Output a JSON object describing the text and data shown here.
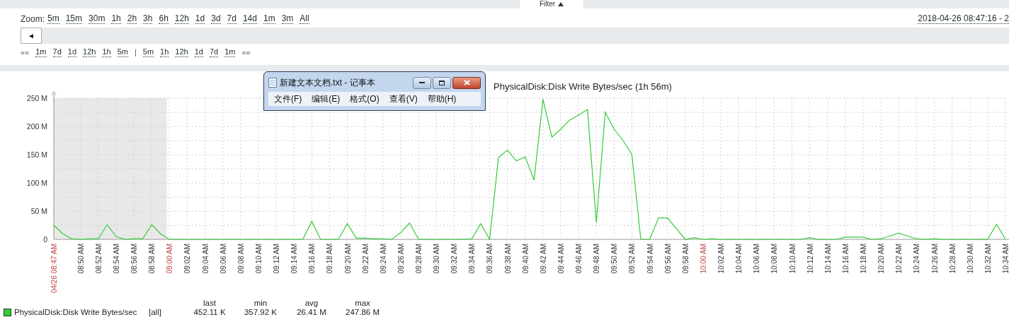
{
  "filter_tab": {
    "label": "Filter"
  },
  "zoom": {
    "label": "Zoom:",
    "options": [
      "5m",
      "15m",
      "30m",
      "1h",
      "2h",
      "3h",
      "6h",
      "12h",
      "1d",
      "3d",
      "7d",
      "14d",
      "1m",
      "3m",
      "All"
    ]
  },
  "time_range": "2018-04-26 08:47:16 - 2",
  "scroll_left_button": {
    "label": "◄"
  },
  "navigation": {
    "back_label": "««",
    "back": [
      "1m",
      "7d",
      "1d",
      "12h",
      "1h",
      "5m"
    ],
    "separator": "|",
    "forward": [
      "5m",
      "1h",
      "12h",
      "1d",
      "7d",
      "1m"
    ],
    "forward_label": "»»"
  },
  "notepad": {
    "title": "新建文本文档.txt - 记事本",
    "menu": [
      "文件(F)",
      "编辑(E)",
      "格式(O)",
      "查看(V)",
      "帮助(H)"
    ]
  },
  "chart": {
    "chart_data": {
      "type": "line",
      "title": "PhysicalDisk:Disk Write Bytes/sec (1h 56m)",
      "categories": [
        "04/26 08:47 AM",
        null,
        null,
        "08:50 AM",
        null,
        "08:52 AM",
        null,
        "08:54 AM",
        null,
        "08:56 AM",
        null,
        "08:58 AM",
        null,
        "09:00 AM",
        null,
        "09:02 AM",
        null,
        "09:04 AM",
        null,
        "09:06 AM",
        null,
        "09:08 AM",
        null,
        "09:10 AM",
        null,
        "09:12 AM",
        null,
        "09:14 AM",
        null,
        "09:16 AM",
        null,
        "09:18 AM",
        null,
        "09:20 AM",
        null,
        "09:22 AM",
        null,
        "09:24 AM",
        null,
        "09:26 AM",
        null,
        "09:28 AM",
        null,
        "09:30 AM",
        null,
        "09:32 AM",
        null,
        "09:34 AM",
        null,
        "09:36 AM",
        null,
        "09:38 AM",
        null,
        "09:40 AM",
        null,
        "09:42 AM",
        null,
        "09:44 AM",
        null,
        "09:46 AM",
        null,
        "09:48 AM",
        null,
        "09:50 AM",
        null,
        "09:52 AM",
        null,
        "09:54 AM",
        null,
        "09:56 AM",
        null,
        "09:58 AM",
        null,
        "10:00 AM",
        null,
        "10:02 AM",
        null,
        "10:04 AM",
        null,
        "10:06 AM",
        null,
        "10:08 AM",
        null,
        "10:10 AM",
        null,
        "10:12 AM",
        null,
        "10:14 AM",
        null,
        "10:16 AM",
        null,
        "10:18 AM",
        null,
        "10:20 AM",
        null,
        "10:22 AM",
        null,
        "10:24 AM",
        null,
        "10:26 AM",
        null,
        "10:28 AM",
        null,
        "10:30 AM",
        null,
        "10:32 AM",
        null,
        "10:34 AM"
      ],
      "series": [
        {
          "name": "PhysicalDisk:Disk Write Bytes/sec",
          "color": "#33cc33",
          "values": [
            25,
            10,
            1,
            0,
            1,
            1,
            26,
            5,
            0,
            1,
            1,
            26,
            10,
            0,
            0,
            0,
            0,
            0,
            0,
            0,
            0,
            0,
            0,
            0,
            0,
            0,
            0,
            0,
            0,
            32,
            0,
            0,
            0,
            28,
            2,
            2,
            1,
            1,
            0,
            12,
            29,
            0,
            0,
            0,
            0,
            0,
            0,
            1,
            28,
            0,
            145,
            158,
            139,
            146,
            105,
            248,
            181,
            195,
            211,
            220,
            230,
            30,
            225,
            195,
            175,
            150,
            0,
            0,
            38,
            38,
            19,
            0,
            3,
            0,
            1,
            0,
            0,
            0,
            0,
            0,
            0,
            0,
            0,
            0,
            0,
            3,
            0,
            0,
            0,
            4,
            4,
            4,
            0,
            1,
            6,
            11,
            6,
            1,
            0,
            1,
            0,
            0,
            0,
            0,
            0,
            0,
            27,
            0
          ]
        }
      ],
      "ylim": [
        0,
        250
      ],
      "yticks": [
        {
          "value": 0,
          "label": "0"
        },
        {
          "value": 50,
          "label": "50 M"
        },
        {
          "value": 100,
          "label": "100 M"
        },
        {
          "value": 150,
          "label": "150 M"
        },
        {
          "value": 200,
          "label": "200 M"
        },
        {
          "value": 250,
          "label": "250 M"
        }
      ],
      "grid": true
    },
    "xtick_styles": [
      {
        "kind": "major"
      },
      {
        "kind": "minor"
      },
      {
        "kind": "minor"
      },
      {
        "kind": "minor"
      },
      {
        "kind": "minor"
      },
      {
        "kind": "minor"
      },
      {
        "kind": "major"
      },
      {
        "kind": "minor"
      },
      {
        "kind": "minor"
      },
      {
        "kind": "minor"
      },
      {
        "kind": "minor"
      },
      {
        "kind": "minor"
      },
      {
        "kind": "minor"
      },
      {
        "kind": "minor"
      },
      {
        "kind": "minor"
      },
      {
        "kind": "minor"
      },
      {
        "kind": "minor"
      },
      {
        "kind": "minor"
      },
      {
        "kind": "minor"
      },
      {
        "kind": "minor"
      },
      {
        "kind": "minor"
      },
      {
        "kind": "minor"
      },
      {
        "kind": "minor"
      },
      {
        "kind": "minor"
      },
      {
        "kind": "minor"
      },
      {
        "kind": "minor"
      },
      {
        "kind": "minor"
      },
      {
        "kind": "minor"
      },
      {
        "kind": "minor"
      },
      {
        "kind": "minor"
      },
      {
        "kind": "minor"
      },
      {
        "kind": "minor"
      },
      {
        "kind": "minor"
      },
      {
        "kind": "minor"
      },
      {
        "kind": "minor"
      },
      {
        "kind": "minor"
      },
      {
        "kind": "major"
      },
      {
        "kind": "minor"
      },
      {
        "kind": "minor"
      },
      {
        "kind": "minor"
      },
      {
        "kind": "minor"
      },
      {
        "kind": "minor"
      },
      {
        "kind": "minor"
      },
      {
        "kind": "minor"
      },
      {
        "kind": "minor"
      },
      {
        "kind": "minor"
      },
      {
        "kind": "minor"
      },
      {
        "kind": "minor"
      },
      {
        "kind": "minor"
      },
      {
        "kind": "minor"
      },
      {
        "kind": "minor"
      },
      {
        "kind": "minor"
      },
      {
        "kind": "minor"
      },
      {
        "kind": "minor"
      }
    ],
    "legend_headings": [
      "last",
      "min",
      "avg",
      "max"
    ],
    "legend": [
      {
        "scope": "[all]",
        "values": [
          "452.11 K",
          "357.92 K",
          "26.41 M",
          "247.86 M"
        ]
      }
    ]
  }
}
